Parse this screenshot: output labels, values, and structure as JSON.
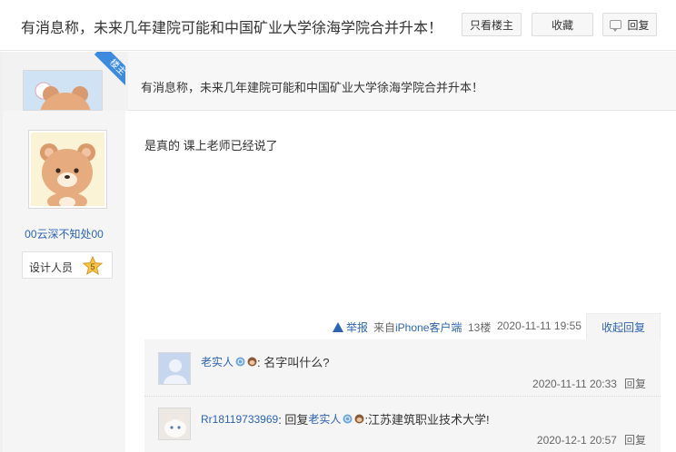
{
  "header": {
    "title": "有消息称，未来几年建院可能和中国矿业大学徐海学院合并升本！",
    "only_lz": "只看楼主",
    "favorite": "收藏",
    "reply": "回复"
  },
  "first_post": {
    "badge": "楼主",
    "text": "有消息称，未来几年建院可能和中国矿业大学徐海学院合并升本！"
  },
  "post": {
    "username": "00云深不知处00",
    "role": "设计人员",
    "level": "5",
    "content": "是真的 课上老师已经说了",
    "report": "举报",
    "client_prefix": "来自",
    "client_name": "iPhone客户端",
    "floor": "13楼",
    "time": "2020-11-11 19:55",
    "collapse": "收起回复"
  },
  "comments": [
    {
      "name": "老实人",
      "text": ": 名字叫什么?",
      "time": "2020-11-11 20:33",
      "reply": "回复"
    },
    {
      "name": "Rr18119733969",
      "prefix": ": 回复 ",
      "reply_to": "老实人",
      "text": " :江苏建筑职业技术大学!",
      "time": "2020-12-1 20:57",
      "reply": "回复"
    }
  ],
  "colors": {
    "link": "#2d64b3",
    "badge": "#3d8be0",
    "side_bg": "#f5f5f5"
  }
}
